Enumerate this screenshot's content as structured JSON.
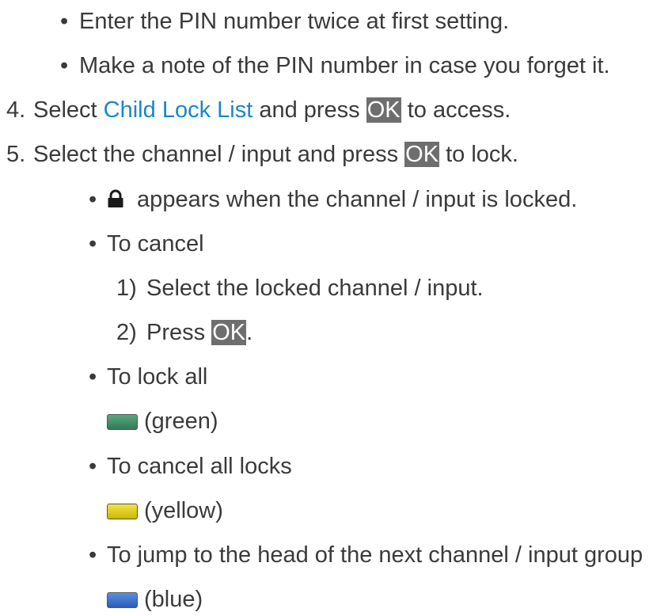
{
  "bullets_top": [
    "Enter the PIN number twice at first setting.",
    "Make a note of the PIN number in case you forget it."
  ],
  "steps": {
    "step4": {
      "number": "4.",
      "pre": "Select ",
      "link": "Child Lock List",
      "mid": " and press ",
      "key": "OK",
      "post": " to access."
    },
    "step5": {
      "number": "5.",
      "pre": "Select the channel / input and press ",
      "key": "OK",
      "post": " to lock."
    }
  },
  "lock_note": " appears when the channel / input is locked.",
  "cancel": {
    "heading": "To cancel",
    "sub1_number": "1)",
    "sub1_text": "Select the locked channel / input.",
    "sub2_number": "2)",
    "sub2_pre": "Press ",
    "sub2_key": "OK",
    "sub2_post": "."
  },
  "lock_all": {
    "heading": "To lock all",
    "color_label": "(green)",
    "color": "#2f7a55"
  },
  "cancel_all": {
    "heading": "To cancel all locks",
    "color_label": "(yellow)",
    "color": "#cdb800"
  },
  "jump": {
    "heading": "To jump to the head of the next channel / input group",
    "color_label": "(blue)",
    "color": "#2a5cb8"
  },
  "bullet_char": "•",
  "icons": {
    "lock": "lock-icon"
  }
}
